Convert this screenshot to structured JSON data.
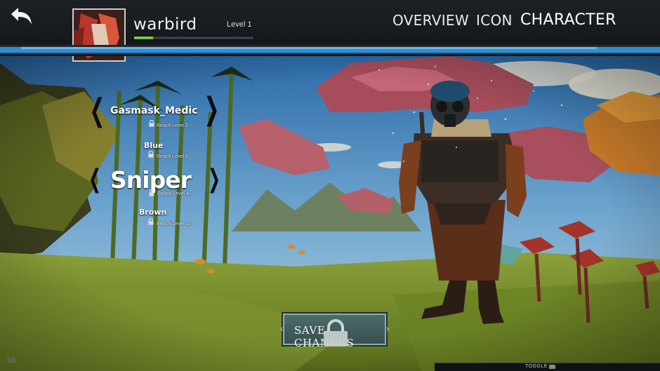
{
  "header": {
    "player_name": "warbird",
    "level_label": "Level 1",
    "xp_progress": 0.16,
    "nav": {
      "overview": "OVERVIEW",
      "icon": "ICON",
      "character": "CHARACTER"
    }
  },
  "skins": [
    {
      "name": "Gasmask_Medic",
      "requirement": "Reach Level 2"
    },
    {
      "name": "Blue",
      "requirement": "Reach Level 5"
    },
    {
      "name": "Sniper",
      "requirement": "Reach Level 4"
    },
    {
      "name": "Brown",
      "requirement": "Reach Level 10"
    }
  ],
  "save_button": {
    "label": "SAVE CHANGES"
  },
  "fps": "50",
  "toggle": {
    "label": "TOGGLE"
  },
  "icons": {
    "back": "back-arrow-icon",
    "lock": "padlock-icon",
    "prev": "chevron-left-icon",
    "next": "chevron-right-icon"
  },
  "colors": {
    "accent_blue": "#2f8fd0",
    "xp_green": "#7fc645",
    "button_teal": "#4c6d6c"
  }
}
